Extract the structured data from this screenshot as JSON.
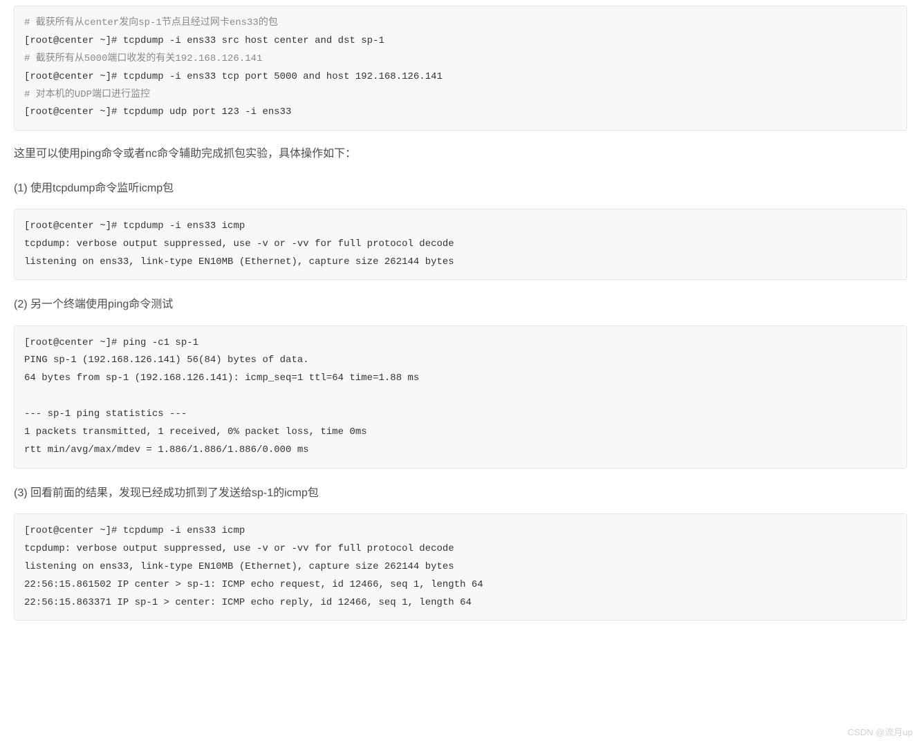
{
  "code1": {
    "c1": "# 截获所有从center发向sp-1节点且经过网卡ens33的包",
    "l1": "[root@center ~]# tcpdump -i ens33 src host center and dst sp-1",
    "c2": "# 截获所有从5000端口收发的有关192.168.126.141",
    "l2": "[root@center ~]# tcpdump -i ens33 tcp port 5000 and host 192.168.126.141",
    "c3": "# 对本机的UDP端口进行监控",
    "l3": "[root@center ~]# tcpdump udp port 123 -i ens33"
  },
  "para1": "这里可以使用ping命令或者nc命令辅助完成抓包实验，具体操作如下：",
  "h1": "(1) 使用tcpdump命令监听icmp包",
  "code2": "[root@center ~]# tcpdump -i ens33 icmp\ntcpdump: verbose output suppressed, use -v or -vv for full protocol decode\nlistening on ens33, link-type EN10MB (Ethernet), capture size 262144 bytes\n",
  "h2": "(2) 另一个终端使用ping命令测试",
  "code3": "[root@center ~]# ping -c1 sp-1\nPING sp-1 (192.168.126.141) 56(84) bytes of data.\n64 bytes from sp-1 (192.168.126.141): icmp_seq=1 ttl=64 time=1.88 ms\n\n--- sp-1 ping statistics ---\n1 packets transmitted, 1 received, 0% packet loss, time 0ms\nrtt min/avg/max/mdev = 1.886/1.886/1.886/0.000 ms",
  "h3": "(3) 回看前面的结果，发现已经成功抓到了发送给sp-1的icmp包",
  "code4": "[root@center ~]# tcpdump -i ens33 icmp\ntcpdump: verbose output suppressed, use -v or -vv for full protocol decode\nlistening on ens33, link-type EN10MB (Ethernet), capture size 262144 bytes\n22:56:15.861502 IP center > sp-1: ICMP echo request, id 12466, seq 1, length 64\n22:56:15.863371 IP sp-1 > center: ICMP echo reply, id 12466, seq 1, length 64",
  "watermark": "CSDN @流月up"
}
